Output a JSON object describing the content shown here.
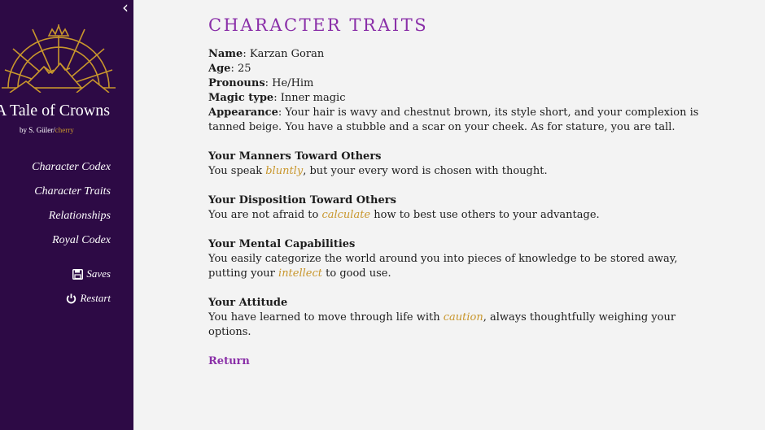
{
  "sidebar": {
    "collapse_glyph": "‹",
    "logo_icon": "sunburst-mountain-crown-icon",
    "title": "A Tale of Crowns",
    "byline_prefix": "by S. Güler/",
    "byline_accent": "cherry",
    "nav": [
      {
        "label": "Character Codex"
      },
      {
        "label": "Character Traits"
      },
      {
        "label": "Relationships"
      },
      {
        "label": "Royal Codex"
      }
    ],
    "saves_label": "Saves",
    "saves_icon": "floppy-disk-icon",
    "restart_label": "Restart",
    "restart_icon": "power-icon",
    "bg_color": "#2d0a45",
    "accent_color": "#c8962c"
  },
  "main": {
    "title": "CHARACTER TRAITS",
    "facts": {
      "name_label": "Name",
      "name_value": ": Karzan Goran",
      "age_label": "Age",
      "age_value": ": 25",
      "pronouns_label": "Pronouns",
      "pronouns_value": ": He/Him",
      "magic_label": "Magic type",
      "magic_value": ": Inner magic",
      "appearance_label": "Appearance",
      "appearance_value": ": Your hair is wavy and chestnut brown, its style short, and your complexion is tanned beige. You have a stubble and a scar on your cheek. As for stature, you are tall."
    },
    "sections": [
      {
        "heading": "Your Manners Toward Others",
        "before": "You speak ",
        "trait": "bluntly",
        "after": ", but your every word is chosen with thought."
      },
      {
        "heading": "Your Disposition Toward Others",
        "before": "You are not afraid to ",
        "trait": "calculate",
        "after": " how to best use others to your advantage."
      },
      {
        "heading": "Your Mental Capabilities",
        "before": "You easily categorize the world around you into pieces of knowledge to be stored away, putting your ",
        "trait": "intellect",
        "after": " to good use."
      },
      {
        "heading": "Your Attitude",
        "before": "You have learned to move through life with ",
        "trait": "caution",
        "after": ", always thoughtfully weighing your options."
      }
    ],
    "return_label": "Return",
    "title_color": "#8a2fa8",
    "trait_color": "#c8962c"
  }
}
